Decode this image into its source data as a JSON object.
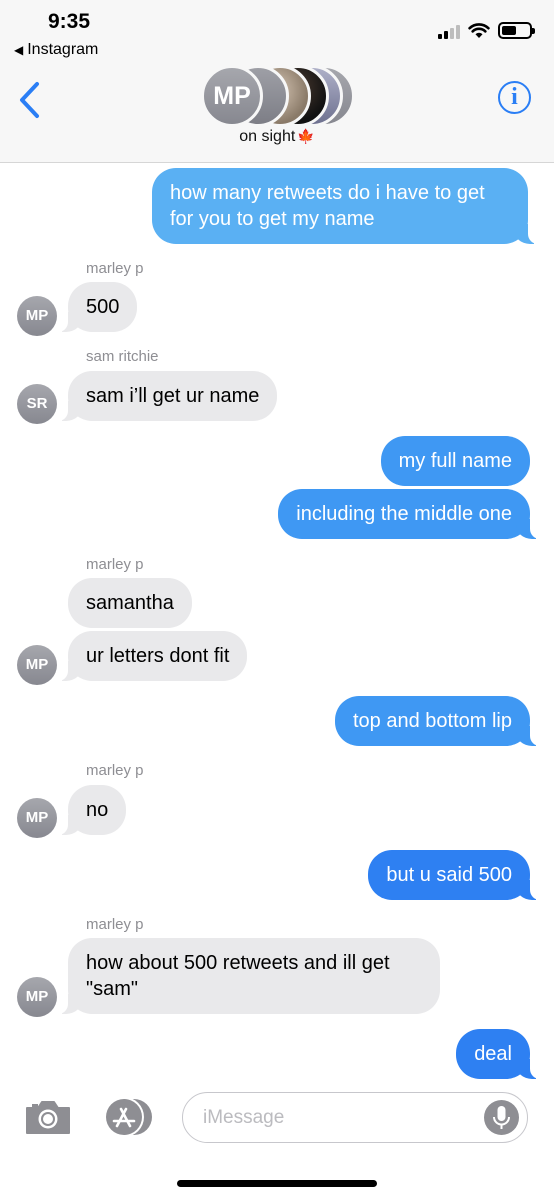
{
  "status_bar": {
    "time": "9:35",
    "back_app": "Instagram"
  },
  "header": {
    "avatar_initials": "MP",
    "group_name": "on sight",
    "group_emoji": "🍁",
    "info_label": "i"
  },
  "messages": [
    {
      "sender": "me",
      "text_lines": [
        "how many retweets do i have to get",
        "for you to get my name"
      ]
    },
    {
      "sender": "marley p",
      "initials": "MP",
      "text": "500"
    },
    {
      "sender": "sam ritchie",
      "initials": "SR",
      "text": "sam i’ll get ur name"
    },
    {
      "sender": "me",
      "text": "my full name"
    },
    {
      "sender": "me",
      "text": "including the middle one"
    },
    {
      "sender": "marley p",
      "text": "samantha"
    },
    {
      "sender": "marley p",
      "initials": "MP",
      "text": "ur letters dont fit"
    },
    {
      "sender": "me",
      "text": "top and bottom lip"
    },
    {
      "sender": "marley p",
      "initials": "MP",
      "text": "no"
    },
    {
      "sender": "me",
      "text": "but u said 500"
    },
    {
      "sender": "marley p",
      "initials": "MP",
      "text_lines": [
        "how about 500 retweets and ill get",
        "\"sam\""
      ]
    },
    {
      "sender": "me",
      "text": "deal"
    }
  ],
  "composer": {
    "placeholder": "iMessage"
  },
  "colors": {
    "ios_blue": "#2a7ef5",
    "bubble_gray": "#e9e9eb",
    "sender_gray": "#8e8e93"
  }
}
